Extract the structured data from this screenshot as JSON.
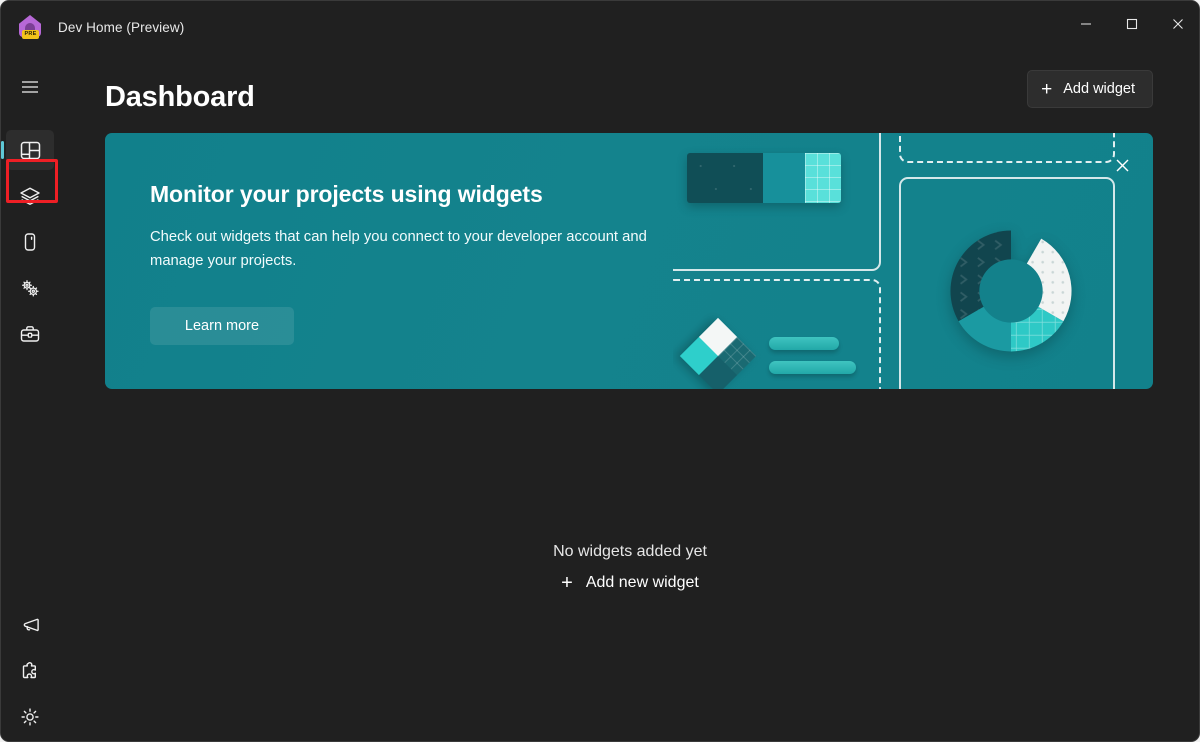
{
  "window": {
    "app_title": "Dev Home (Preview)",
    "app_icon": "dev-home-house-icon",
    "icon_badge": "PRE",
    "controls": {
      "minimize": "minimize-icon",
      "maximize": "maximize-icon",
      "close": "close-icon"
    }
  },
  "sidebar": {
    "menu_toggle": "hamburger-menu-icon",
    "items": [
      {
        "id": "dashboard",
        "icon": "dashboard-layout-icon",
        "selected": true
      },
      {
        "id": "machine-configuration",
        "icon": "layers-stack-icon",
        "selected": false
      },
      {
        "id": "environments",
        "icon": "device-icon",
        "selected": false
      },
      {
        "id": "utilities",
        "icon": "gears-icon",
        "selected": false
      },
      {
        "id": "toolbox",
        "icon": "toolbox-icon",
        "selected": false
      }
    ],
    "bottom_items": [
      {
        "id": "feedback",
        "icon": "megaphone-icon"
      },
      {
        "id": "extensions",
        "icon": "puzzle-piece-icon"
      },
      {
        "id": "settings",
        "icon": "gear-icon"
      }
    ],
    "highlight_target": "layers-stack-icon"
  },
  "header": {
    "title": "Dashboard",
    "add_widget_label": "Add widget",
    "add_widget_icon": "plus-icon"
  },
  "banner": {
    "heading": "Monitor your projects using widgets",
    "body": "Check out widgets that can help you connect to your developer account and manage your projects.",
    "cta_label": "Learn more",
    "close_icon": "close-icon",
    "illustration": {
      "bar_segments": [
        "dark-teal-dotted",
        "medium-teal",
        "bright-teal-grid"
      ],
      "diamond_quadrants": [
        "white",
        "dark-teal-grid",
        "bright-teal",
        "deep-teal"
      ],
      "pill_bars": 2,
      "donut_segments": [
        "dark-teal",
        "medium-teal",
        "bright-teal-grid",
        "white-dotted"
      ]
    }
  },
  "empty_state": {
    "title": "No widgets added yet",
    "add_label": "Add new widget",
    "add_icon": "plus-icon"
  },
  "colors": {
    "window_bg": "#202020",
    "banner_teal": "#13818b",
    "accent_indicator": "#5ec8d6",
    "highlight_red": "#ee1f25",
    "button_bg": "#2d2d2d",
    "text_primary": "#ffffff"
  }
}
